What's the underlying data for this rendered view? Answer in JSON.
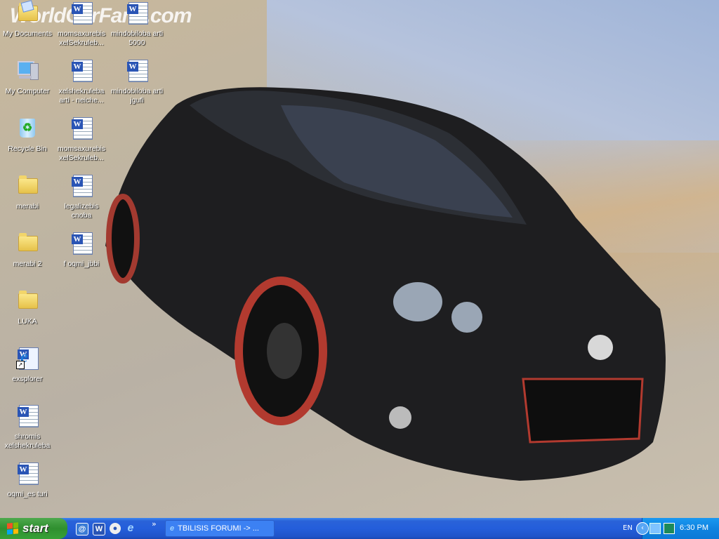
{
  "wallpaper": {
    "watermark": "WorldCarFans.com"
  },
  "desktop_icons": [
    {
      "label": "My Documents",
      "type": "mydocs"
    },
    {
      "label": "momsaxurebis xelSekruleb...",
      "type": "doc"
    },
    {
      "label": "mindobiloba arti 5000",
      "type": "doc"
    },
    {
      "label": "My Computer",
      "type": "computer"
    },
    {
      "label": "xelshekruleba arti - neiche...",
      "type": "doc"
    },
    {
      "label": "mindobiloba arti  jgufi",
      "type": "doc"
    },
    {
      "label": "Recycle Bin",
      "type": "recycle"
    },
    {
      "label": "momsaxurebis xelSekruleb...",
      "type": "doc"
    },
    {
      "label": "merabi",
      "type": "folder"
    },
    {
      "label": "legalizebis cnoba",
      "type": "doc"
    },
    {
      "label": "merabi 2",
      "type": "folder"
    },
    {
      "label": "f oqmi_jbbi",
      "type": "doc"
    },
    {
      "label": "LUKA",
      "type": "folder"
    },
    {
      "label": "exsplorer",
      "type": "ie"
    },
    {
      "label": "shromis xelshekruleba",
      "type": "doc"
    },
    {
      "label": "oqmi_es turi",
      "type": "doc"
    }
  ],
  "taskbar": {
    "start_label": "start",
    "chevron": "»",
    "task_label": "TBILISIS FORUMI -> ...",
    "language": "EN",
    "clock": "6:30 PM"
  }
}
